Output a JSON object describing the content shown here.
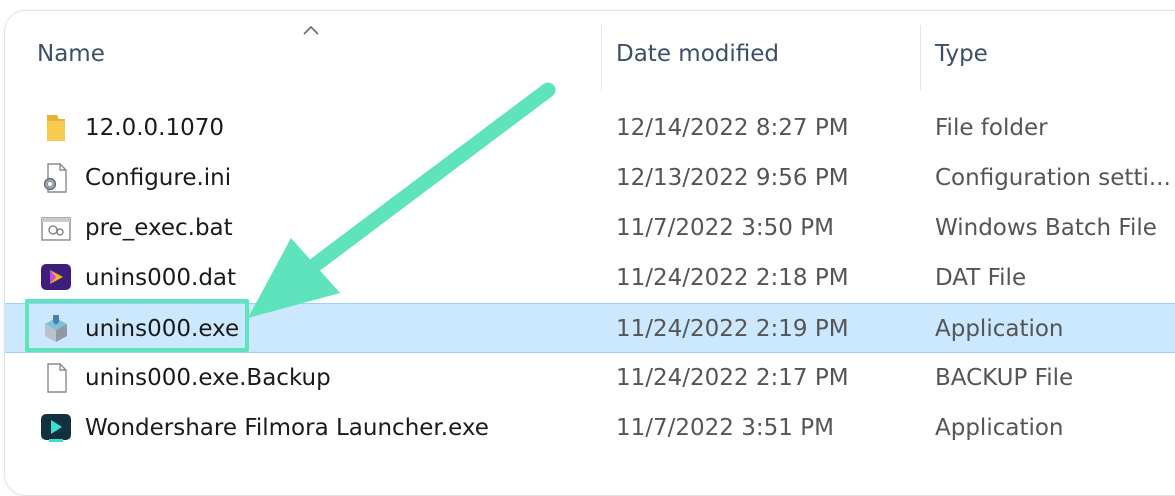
{
  "columns": {
    "name": "Name",
    "date_modified": "Date modified",
    "type": "Type"
  },
  "files": [
    {
      "name": "12.0.0.1070",
      "date": "12/14/2022 8:27 PM",
      "type": "File folder",
      "icon": "folder-icon",
      "selected": false
    },
    {
      "name": "Configure.ini",
      "date": "12/13/2022 9:56 PM",
      "type": "Configuration setti...",
      "icon": "settings-file-icon",
      "selected": false
    },
    {
      "name": "pre_exec.bat",
      "date": "11/7/2022 3:50 PM",
      "type": "Windows Batch File",
      "icon": "batch-file-icon",
      "selected": false
    },
    {
      "name": "unins000.dat",
      "date": "11/24/2022 2:18 PM",
      "type": "DAT File",
      "icon": "filmora-icon",
      "selected": false
    },
    {
      "name": "unins000.exe",
      "date": "11/24/2022 2:19 PM",
      "type": "Application",
      "icon": "installer-icon",
      "selected": true
    },
    {
      "name": "unins000.exe.Backup",
      "date": "11/24/2022 2:17 PM",
      "type": "BACKUP File",
      "icon": "blank-file-icon",
      "selected": false
    },
    {
      "name": "Wondershare Filmora Launcher.exe",
      "date": "11/7/2022 3:51 PM",
      "type": "Application",
      "icon": "filmora-launcher-icon",
      "selected": false
    }
  ],
  "colors": {
    "highlight": "#5ee3bc",
    "selection": "#cce8ff",
    "header_text": "#3c4f66"
  }
}
